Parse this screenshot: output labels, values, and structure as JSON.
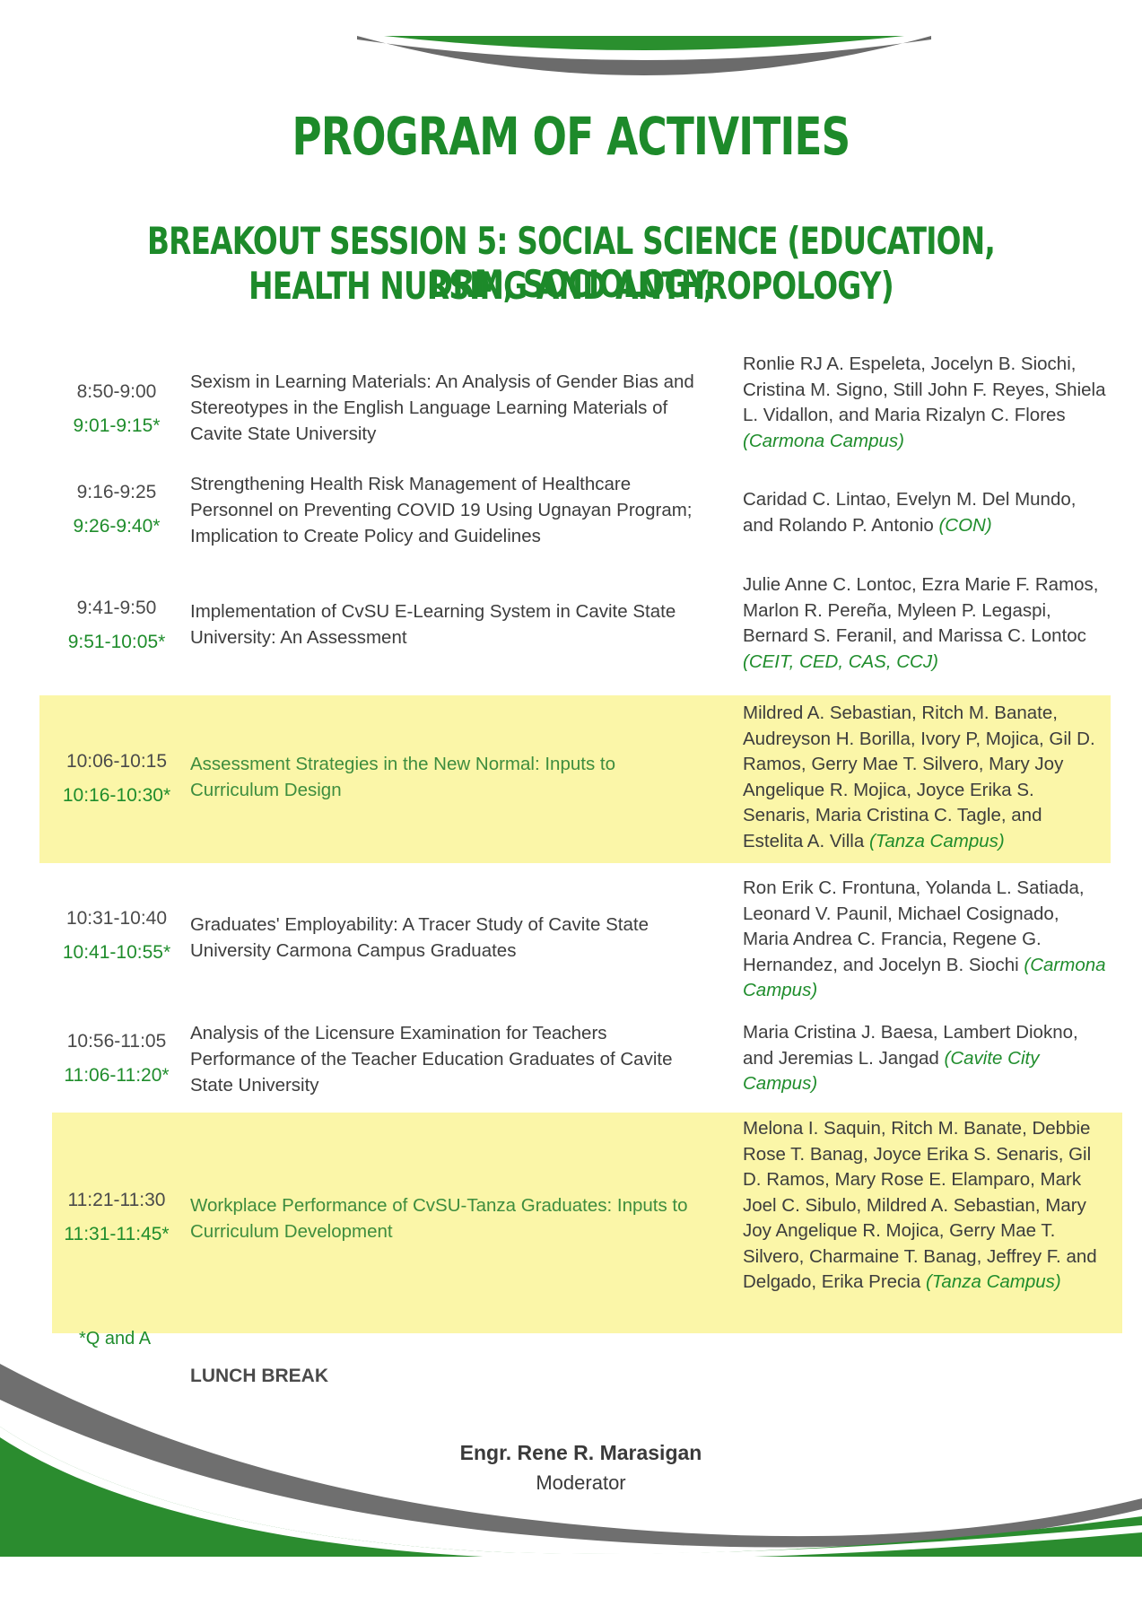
{
  "title": "PROGRAM OF ACTIVITIES",
  "subtitle_line1": "BREAKOUT SESSION 5: SOCIAL SCIENCE (EDUCATION, DRM, SOCIOLOGY,",
  "subtitle_line2": "HEALTH NURSING AND ANTHROPOLOGY)",
  "sessions": [
    {
      "time": "8:50-9:00",
      "qa_time": "9:01-9:15*",
      "topic": "Sexism in Learning Materials: An Analysis of Gender Bias and Stereotypes in the English Language Learning Materials of Cavite State University",
      "authors": "Ronlie RJ A. Espeleta, Jocelyn B. Siochi, Cristina M. Signo, Still John F. Reyes, Shiela L. Vidallon, and Maria Rizalyn C. Flores",
      "campus": "(Carmona Campus)"
    },
    {
      "time": "9:16-9:25",
      "qa_time": "9:26-9:40*",
      "topic": "Strengthening Health Risk Management of Healthcare Personnel on Preventing COVID 19 Using Ugnayan Program; Implication to Create Policy and Guidelines",
      "authors": "Caridad C. Lintao, Evelyn M. Del Mundo, and Rolando P. Antonio",
      "campus": "(CON)"
    },
    {
      "time": "9:41-9:50",
      "qa_time": "9:51-10:05*",
      "topic": "Implementation of CvSU E-Learning System in Cavite State University: An Assessment",
      "authors": "Julie Anne C. Lontoc, Ezra Marie F. Ramos, Marlon R. Pereña, Myleen P. Legaspi, Bernard S. Feranil, and Marissa C. Lontoc",
      "campus": "(CEIT, CED, CAS, CCJ)"
    },
    {
      "time": "10:06-10:15",
      "qa_time": "10:16-10:30*",
      "topic": "Assessment Strategies in the New Normal: Inputs to Curriculum Design",
      "authors": "Mildred A. Sebastian, Ritch M. Banate, Audreyson H. Borilla, Ivory P, Mojica, Gil D. Ramos, Gerry Mae T. Silvero, Mary Joy Angelique R. Mojica, Joyce Erika S. Senaris, Maria Cristina C. Tagle, and Estelita A. Villa",
      "campus": "(Tanza Campus)"
    },
    {
      "time": "10:31-10:40",
      "qa_time": "10:41-10:55*",
      "topic": "Graduates' Employability: A Tracer Study of Cavite State University Carmona Campus Graduates",
      "authors": "Ron Erik C. Frontuna, Yolanda L. Satiada, Leonard V. Paunil, Michael Cosignado, Maria Andrea C. Francia, Regene G. Hernandez, and Jocelyn B. Siochi",
      "campus": "(Carmona Campus)"
    },
    {
      "time": "10:56-11:05",
      "qa_time": "11:06-11:20*",
      "topic": "Analysis of the Licensure Examination for Teachers Performance of the Teacher Education Graduates of Cavite State University",
      "authors": "Maria Cristina J. Baesa, Lambert Diokno, and Jeremias L. Jangad",
      "campus": "(Cavite City Campus)"
    },
    {
      "time": "11:21-11:30",
      "qa_time": "11:31-11:45*",
      "topic": "Workplace Performance of CvSU-Tanza Graduates: Inputs to Curriculum Development",
      "authors": "Melona I. Saquin, Ritch M. Banate, Debbie Rose T. Banag, Joyce Erika S. Senaris, Gil D. Ramos, Mary Rose E. Elamparo, Mark Joel C. Sibulo, Mildred A. Sebastian, Mary Joy Angelique R. Mojica, Gerry Mae T. Silvero, Charmaine T. Banag, Jeffrey F. and Delgado, Erika Precia",
      "campus": "(Tanza Campus)"
    }
  ],
  "note": "*Q and A",
  "lunch": "LUNCH BREAK",
  "moderator_name": "Engr. Rene R. Marasigan",
  "moderator_role": "Moderator",
  "colors": {
    "accent_green": "#1d8a2a",
    "highlight_yellow": "#fbf6a8",
    "swoosh_gray": "#6b6b6b"
  }
}
